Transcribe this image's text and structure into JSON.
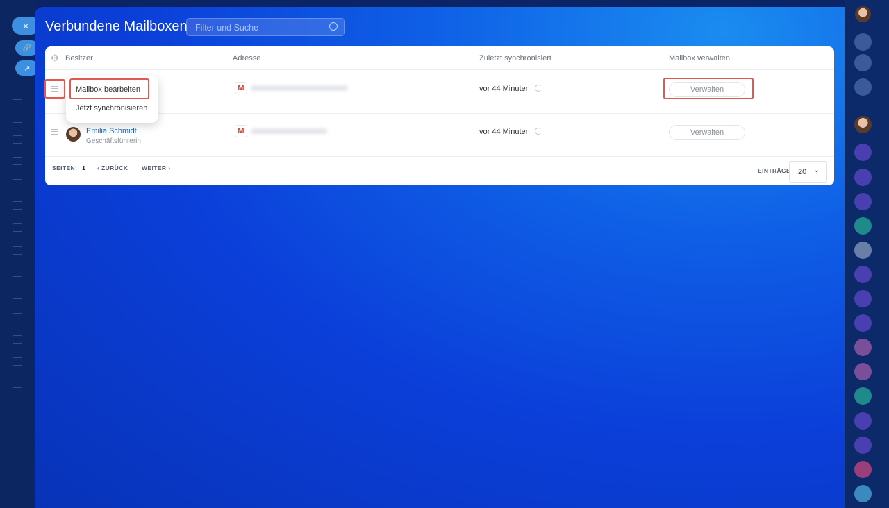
{
  "title": "Verbundene Mailboxen",
  "search": {
    "placeholder": "Filter und Suche"
  },
  "table": {
    "headers": [
      "Besitzer",
      "Adresse",
      "Zuletzt synchronisiert",
      "Mailbox verwalten"
    ],
    "rows": [
      {
        "owner": "",
        "role": "",
        "last_sync": "vor 44 Minuten",
        "action": "Verwalten"
      },
      {
        "owner": "Emilia Schmidt",
        "role": "Geschäftsführerin",
        "last_sync": "vor 44 Minuten",
        "action": "Verwalten"
      }
    ]
  },
  "context_menu": {
    "items": [
      "Mailbox bearbeiten",
      "Jetzt synchronisieren"
    ]
  },
  "pagination": {
    "pages_label": "SEITEN:",
    "page": "1",
    "back": "ZURÜCK",
    "next": "WEITER",
    "entries_label": "EINTRÄGE",
    "entries_value": "20"
  },
  "close_icon": "×",
  "colors": {
    "highlight": "#e0584e",
    "link": "#2067b0"
  }
}
